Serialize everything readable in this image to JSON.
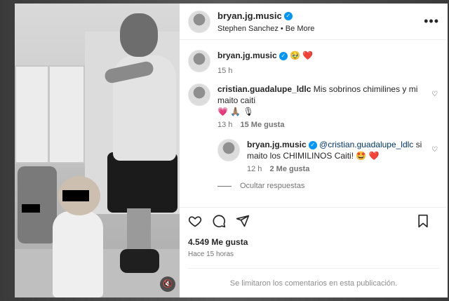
{
  "post": {
    "username": "bryan.jg.music",
    "audio": "Stephen Sanchez • Be More",
    "more_label": "•••"
  },
  "caption": {
    "username": "bryan.jg.music",
    "emojis": "🥹 ❤️",
    "time": "15 h"
  },
  "comments": [
    {
      "username": "cristian.guadalupe_ldlc",
      "text": "Mis sobrinos chimilines y mi maito caiti",
      "emojis": "💗 🙏🏽 🎙",
      "time": "13 h",
      "likes": "15 Me gusta"
    }
  ],
  "reply": {
    "username": "bryan.jg.music",
    "mention": "@cristian.guadalupe_ldlc",
    "text": "si maito los CHIMILINOS Caiti!",
    "emojis": "🤩 ❤️",
    "time": "12 h",
    "likes": "2 Me gusta"
  },
  "hide_replies": "Ocultar respuestas",
  "likes_count": "4.549 Me gusta",
  "posted_ago": "Hace 15 horas",
  "comments_limited": "Se limitaron los comentarios en esta publicación.",
  "colors": {
    "verified": "#0095f6",
    "heart": "#ed2a54",
    "mention": "#00376b"
  }
}
